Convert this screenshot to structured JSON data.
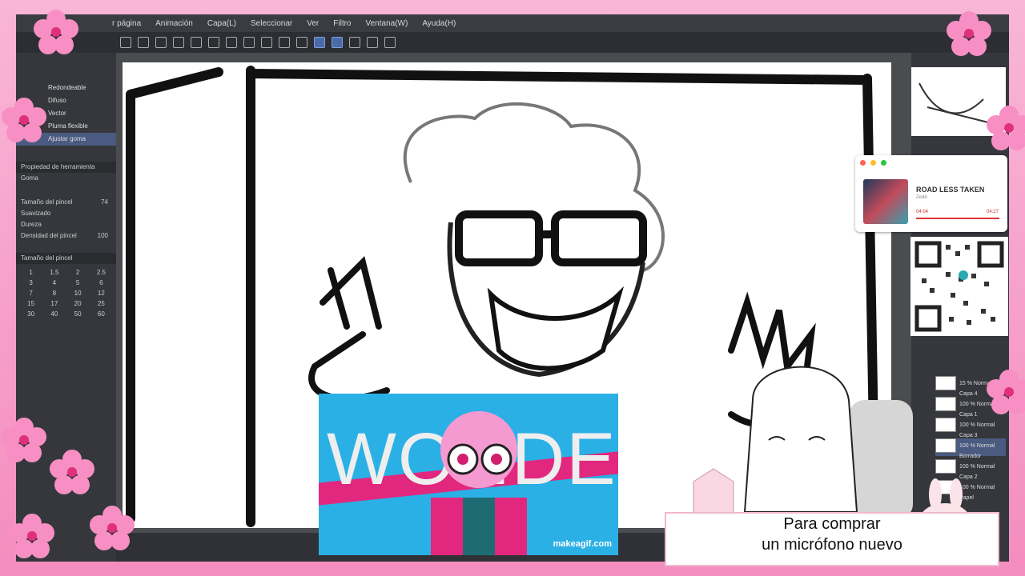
{
  "menu": [
    "r página",
    "Animación",
    "Capa(L)",
    "Seleccionar",
    "Ver",
    "Filtro",
    "Ventana(W)",
    "Ayuda(H)"
  ],
  "left_panel": {
    "brush_items": [
      "Redondeable",
      "Difuso",
      "Vector",
      "Pluma flexible",
      "Ajustar goma"
    ],
    "tool_property_header": "Propiedad de herramienta",
    "tool_name": "Goma",
    "fields": [
      {
        "label": "Tamaño del pincel",
        "value": "74"
      },
      {
        "label": "Suavizado",
        "value": ""
      },
      {
        "label": "Dureza",
        "value": ""
      },
      {
        "label": "Densidad del pincel",
        "value": "100"
      }
    ],
    "brush_size_header": "Tamaño del pincel",
    "brush_sizes": [
      "1",
      "1.5",
      "2",
      "2.5",
      "3",
      "4",
      "5",
      "6",
      "7",
      "8",
      "10",
      "12",
      "15",
      "17",
      "20",
      "25",
      "30",
      "40",
      "50",
      "60"
    ]
  },
  "music_player": {
    "song": "ROAD LESS TAKEN",
    "artist": "Zedd",
    "elapsed": "04:04",
    "total": "04:27",
    "dot_colors": [
      "#ff5f57",
      "#febc2e",
      "#28c840"
    ]
  },
  "layers": [
    {
      "opacity": "15 % Normal",
      "name": "Capa 4"
    },
    {
      "opacity": "100 % Normal",
      "name": "Capa 1"
    },
    {
      "opacity": "100 % Normal",
      "name": "Capa 3"
    },
    {
      "opacity": "100 % Normal",
      "name": "Borrador"
    },
    {
      "opacity": "100 % Normal",
      "name": "Capa 2"
    },
    {
      "opacity": "100 % Normal",
      "name": "Papel"
    }
  ],
  "gif": {
    "text": "WONDERJOY",
    "watermark": "makeagif.com"
  },
  "caption": {
    "line1": "Para comprar",
    "line2": "un micrófono nuevo"
  },
  "colors": {
    "frame_pink": "#f48dbf",
    "app_bg": "#2f3136",
    "gif_blue": "#2bb0e6",
    "gif_pink": "#e2277f"
  }
}
